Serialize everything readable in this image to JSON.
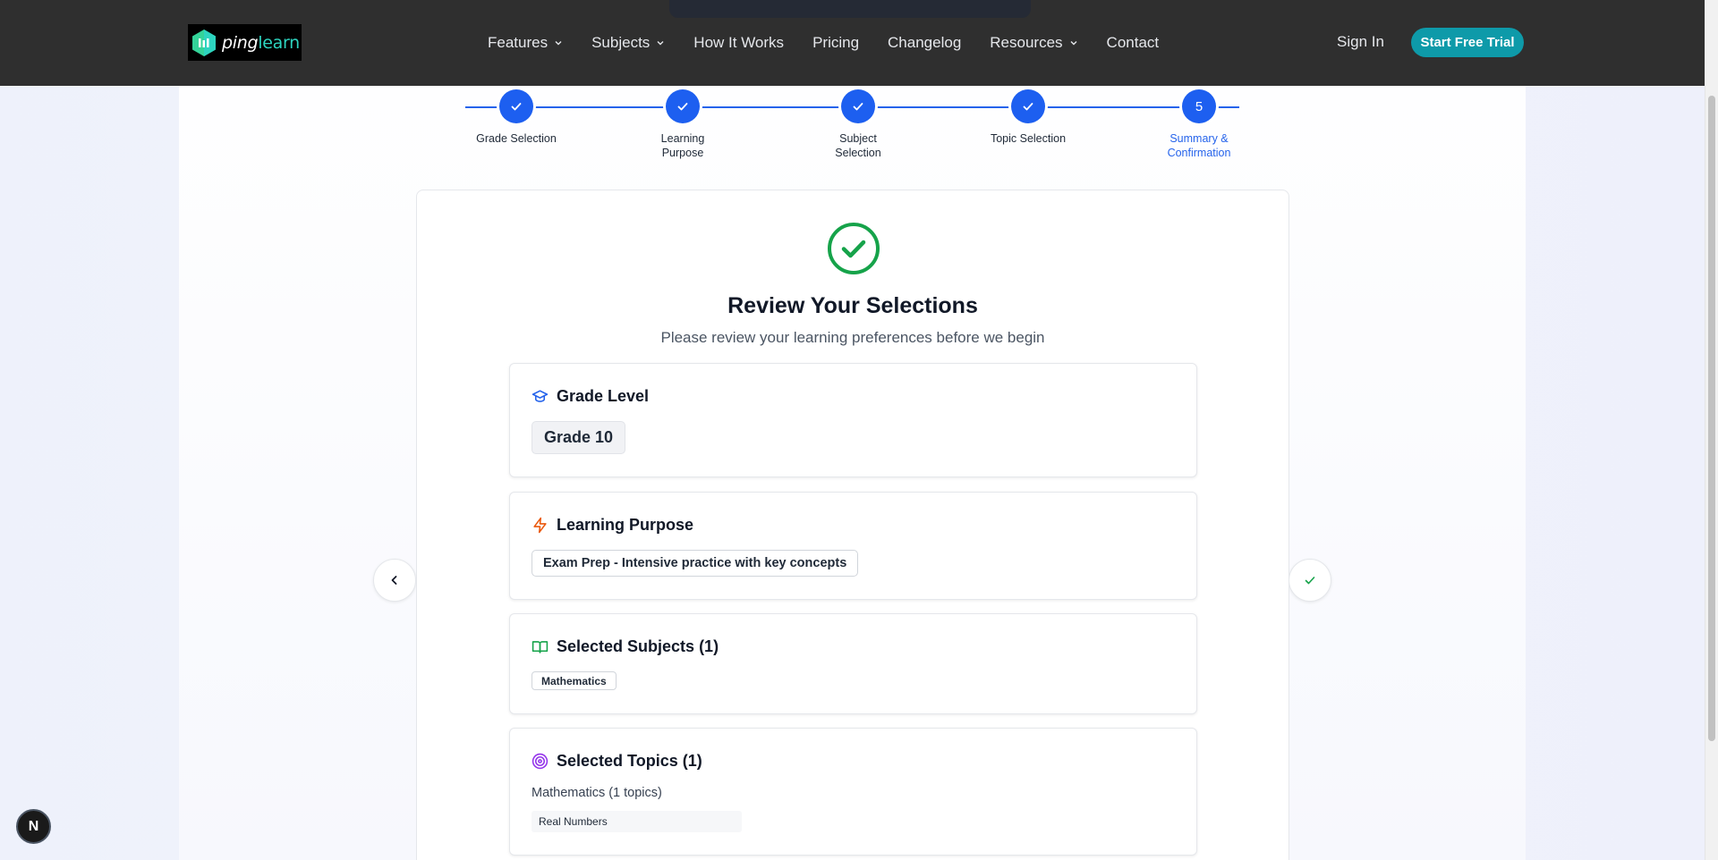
{
  "nav": {
    "logo": {
      "ping": "ping",
      "learn": "learn"
    },
    "links": [
      {
        "label": "Features",
        "dropdown": true
      },
      {
        "label": "Subjects",
        "dropdown": true
      },
      {
        "label": "How It Works",
        "dropdown": false
      },
      {
        "label": "Pricing",
        "dropdown": false
      },
      {
        "label": "Changelog",
        "dropdown": false
      },
      {
        "label": "Resources",
        "dropdown": true
      },
      {
        "label": "Contact",
        "dropdown": false
      }
    ],
    "signin": "Sign In",
    "trial": "Start Free Trial"
  },
  "stepper": {
    "steps": [
      {
        "label": "Grade Selection",
        "status": "done"
      },
      {
        "label": "Learning Purpose",
        "status": "done"
      },
      {
        "label": "Subject Selection",
        "status": "done"
      },
      {
        "label": "Topic Selection",
        "status": "done"
      },
      {
        "label": "Summary & Confirmation",
        "status": "active",
        "number": "5"
      }
    ]
  },
  "review": {
    "title": "Review Your Selections",
    "subtitle": "Please review your learning preferences before we begin",
    "grade": {
      "heading": "Grade Level",
      "value": "Grade 10"
    },
    "purpose": {
      "heading": "Learning Purpose",
      "value": "Exam Prep - Intensive practice with key concepts"
    },
    "subjects": {
      "heading": "Selected Subjects (1)",
      "items": [
        "Mathematics"
      ]
    },
    "topics": {
      "heading": "Selected Topics (1)",
      "group_label": "Mathematics (1 topics)",
      "items": [
        "Real Numbers"
      ]
    }
  },
  "colors": {
    "navbar": "#2f2f2f",
    "primary": "#1d5ff0",
    "accent": "#0e9aa9",
    "success": "#16a34a",
    "grade_icon": "#2563eb",
    "purpose_icon": "#ea580c",
    "subjects_icon": "#16a34a",
    "topics_icon": "#9333ea"
  },
  "badge": {
    "letter": "N"
  }
}
